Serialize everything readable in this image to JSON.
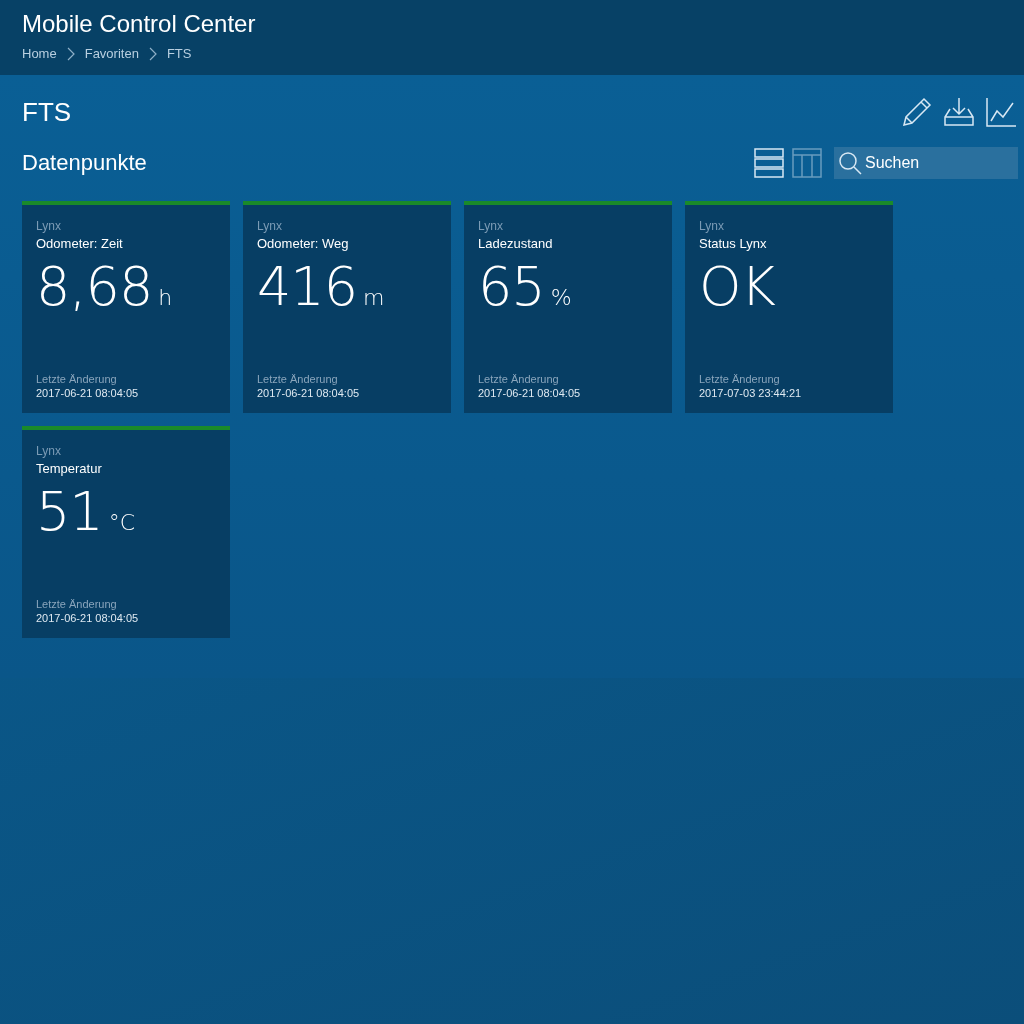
{
  "header": {
    "title": "Mobile Control Center",
    "breadcrumb": [
      "Home",
      "Favoriten",
      "FTS"
    ]
  },
  "page": {
    "title": "FTS",
    "actions": [
      {
        "kind": "edit"
      },
      {
        "kind": "download"
      },
      {
        "kind": "chart"
      }
    ]
  },
  "section": {
    "title": "Datenpunkte",
    "views": [
      {
        "kind": "list",
        "selected": true
      },
      {
        "kind": "columns",
        "selected": false
      }
    ],
    "search": {
      "placeholder": "Suchen"
    }
  },
  "tiles": [
    {
      "source": "Lynx",
      "name": "Odometer: Zeit",
      "value": "8,68",
      "unit": "h",
      "changed_label": "Letzte Änderung",
      "changed": "2017-06-21 08:04:05",
      "color": "#1a8a2a"
    },
    {
      "source": "Lynx",
      "name": "Odometer: Weg",
      "value": "416",
      "unit": "m",
      "changed_label": "Letzte Änderung",
      "changed": "2017-06-21 08:04:05",
      "color": "#1a8a2a"
    },
    {
      "source": "Lynx",
      "name": "Ladezustand",
      "value": "65",
      "unit": "%",
      "changed_label": "Letzte Änderung",
      "changed": "2017-06-21 08:04:05",
      "color": "#1a8a2a"
    },
    {
      "source": "Lynx",
      "name": "Status Lynx",
      "value": "OK",
      "changed_label": "Letzte Änderung",
      "changed": "2017-07-03 23:44:21",
      "color": "#1a8a2a"
    },
    {
      "source": "Lynx",
      "name": "Temperatur",
      "value": "51",
      "unit": "°C",
      "changed_label": "Letzte Änderung",
      "changed": "2017-06-21 08:04:05",
      "color": "#1a8a2a"
    }
  ]
}
